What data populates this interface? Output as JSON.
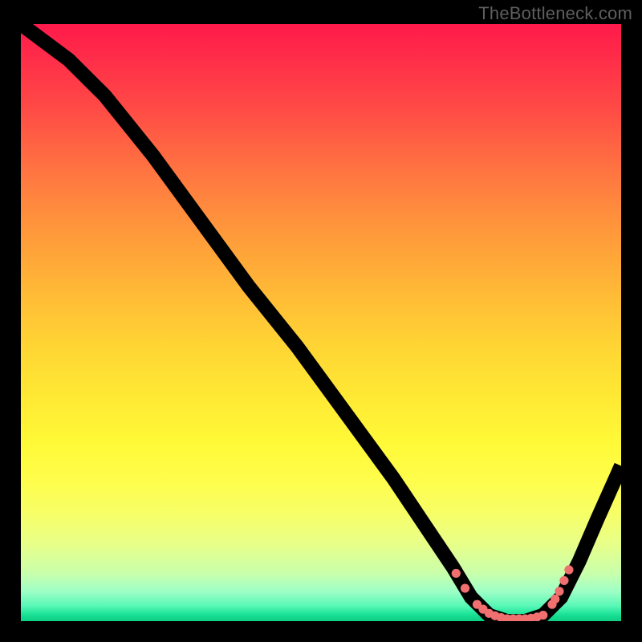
{
  "watermark": "TheBottleneck.com",
  "chart_data": {
    "type": "line",
    "title": "",
    "xlabel": "",
    "ylabel": "",
    "xlim": [
      0,
      100
    ],
    "ylim": [
      0,
      100
    ],
    "series": [
      {
        "name": "bottleneck-curve",
        "x": [
          0,
          4,
          8,
          14,
          22,
          30,
          38,
          46,
          54,
          62,
          68,
          72,
          75,
          78,
          81,
          84,
          87,
          90,
          93,
          96,
          100
        ],
        "y": [
          100,
          97,
          94,
          88,
          78,
          67,
          56,
          46,
          35,
          24,
          15,
          9,
          4,
          1,
          0,
          0,
          1,
          4,
          10,
          17,
          26
        ]
      }
    ],
    "markers": {
      "name": "highlight-dots",
      "x": [
        72.5,
        74.0,
        76.0,
        77.0,
        78.0,
        79.0,
        80.0,
        81.0,
        82.0,
        83.0,
        84.0,
        85.0,
        86.0,
        87.0,
        88.5,
        89.0,
        89.7,
        90.5,
        91.3
      ],
      "y": [
        8.0,
        5.5,
        2.8,
        2.0,
        1.3,
        0.9,
        0.6,
        0.4,
        0.4,
        0.4,
        0.4,
        0.5,
        0.7,
        1.0,
        2.8,
        3.7,
        5.0,
        6.8,
        8.6
      ]
    },
    "gradient_stops": [
      {
        "pos": 0.0,
        "color": "#ff1a4b"
      },
      {
        "pos": 0.5,
        "color": "#ffd534"
      },
      {
        "pos": 0.85,
        "color": "#f0ff78"
      },
      {
        "pos": 1.0,
        "color": "#0dcf85"
      }
    ]
  }
}
